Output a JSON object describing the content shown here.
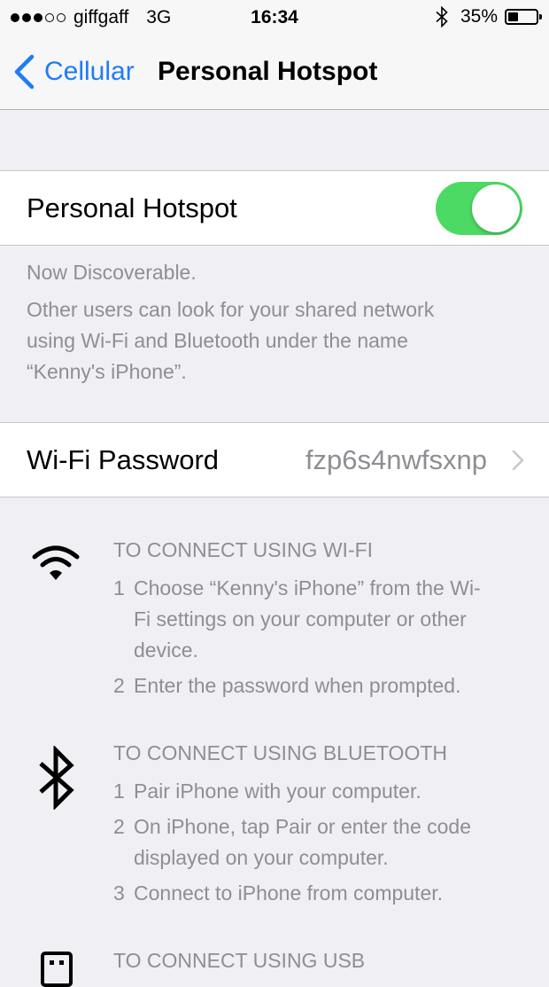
{
  "status_bar": {
    "signal_bars_filled": 3,
    "signal_bars_total": 5,
    "carrier": "giffgaff",
    "network": "3G",
    "time": "16:34",
    "battery_percent": "35%",
    "battery_level": 0.35,
    "bluetooth_icon": "bluetooth-icon"
  },
  "nav": {
    "back_label": "Cellular",
    "title": "Personal Hotspot",
    "back_icon": "chevron-left-icon",
    "tint_color": "#1f7cf5"
  },
  "hotspot": {
    "label": "Personal Hotspot",
    "enabled": true,
    "toggle_on_color": "#4cd964"
  },
  "discoverable": {
    "status": "Now Discoverable.",
    "description_line1": "Other users can look for your shared network",
    "description_line2": "using Wi-Fi and Bluetooth under the name",
    "description_line3": "“Kenny's iPhone”."
  },
  "wifi_password": {
    "label": "Wi-Fi Password",
    "value": "fzp6s4nwfsxnp",
    "disclosure_icon": "chevron-right-icon"
  },
  "instructions": {
    "wifi": {
      "icon": "wifi-icon",
      "heading": "TO CONNECT USING WI-FI",
      "steps": [
        {
          "num": "1",
          "line1": "Choose “Kenny's iPhone” from the Wi-",
          "line2": "Fi settings on your computer or other",
          "line3": "device."
        },
        {
          "num": "2",
          "line1": "Enter the password when prompted."
        }
      ]
    },
    "bluetooth": {
      "icon": "bluetooth-icon",
      "heading": "TO CONNECT USING BLUETOOTH",
      "steps": [
        {
          "num": "1",
          "line1": "Pair iPhone with your computer."
        },
        {
          "num": "2",
          "line1": "On iPhone, tap Pair or enter the code",
          "line2": "displayed on your computer."
        },
        {
          "num": "3",
          "line1": "Connect to iPhone from computer."
        }
      ]
    },
    "usb": {
      "icon": "usb-icon",
      "heading": "TO CONNECT USING USB"
    }
  }
}
